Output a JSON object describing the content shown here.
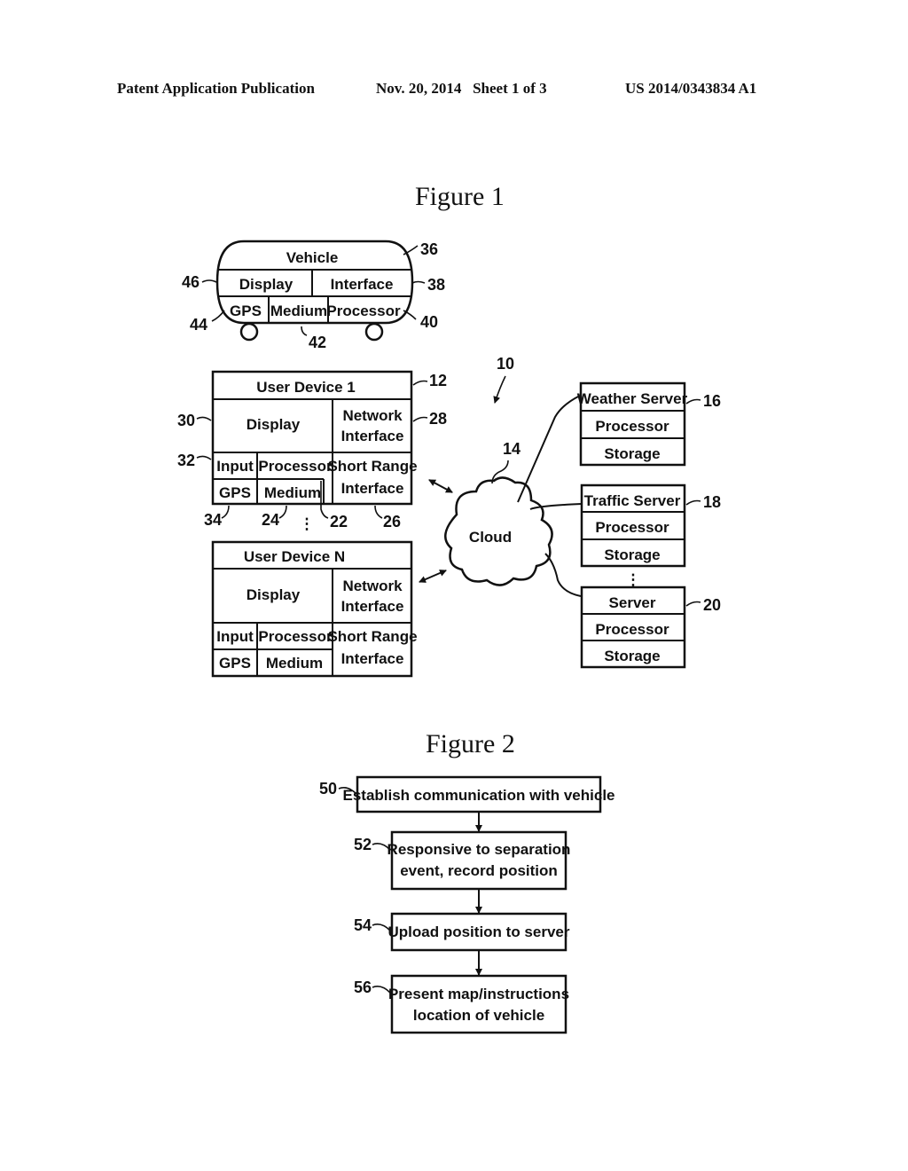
{
  "header": {
    "publication": "Patent Application Publication",
    "date_sheet": "Nov. 20, 2014   Sheet 1 of 3",
    "number": "US 2014/0343834 A1"
  },
  "figure1": {
    "title": "Figure 1",
    "system_ref": "10",
    "vehicle": {
      "title": "Vehicle",
      "display": "Display",
      "interface": "Interface",
      "gps": "GPS",
      "medium": "Medium",
      "processor": "Processor",
      "refs": {
        "vehicle": "36",
        "interface": "38",
        "processor": "40",
        "medium": "42",
        "gps": "44",
        "display": "46"
      }
    },
    "user_device_1": {
      "title": "User Device 1",
      "display": "Display",
      "network_interface_1": "Network",
      "network_interface_2": "Interface",
      "input": "Input",
      "processor": "Processor",
      "gps": "GPS",
      "medium": "Medium",
      "short_range_1": "Short Range",
      "short_range_2": "Interface",
      "refs": {
        "device": "12",
        "network": "28",
        "display": "30",
        "input": "32",
        "gps": "34",
        "medium": "24",
        "processor": "22",
        "short_range": "26"
      }
    },
    "user_device_n": {
      "title": "User Device N",
      "display": "Display",
      "network_interface_1": "Network",
      "network_interface_2": "Interface",
      "input": "Input",
      "processor": "Processor",
      "gps": "GPS",
      "medium": "Medium",
      "short_range_1": "Short Range",
      "short_range_2": "Interface"
    },
    "cloud": {
      "label": "Cloud",
      "ref": "14"
    },
    "servers": [
      {
        "title": "Weather Server",
        "processor": "Processor",
        "storage": "Storage",
        "ref": "16"
      },
      {
        "title": "Traffic Server",
        "processor": "Processor",
        "storage": "Storage",
        "ref": "18"
      },
      {
        "title": "Server",
        "processor": "Processor",
        "storage": "Storage",
        "ref": "20"
      }
    ],
    "ellipsis": "⋮"
  },
  "figure2": {
    "title": "Figure 2",
    "steps": [
      {
        "ref": "50",
        "line1": "Establish communication with vehicle",
        "line2": ""
      },
      {
        "ref": "52",
        "line1": "Responsive to separation",
        "line2": "event, record position"
      },
      {
        "ref": "54",
        "line1": "Upload position to server",
        "line2": ""
      },
      {
        "ref": "56",
        "line1": "Present map/instructions",
        "line2": "location of vehicle"
      }
    ]
  }
}
